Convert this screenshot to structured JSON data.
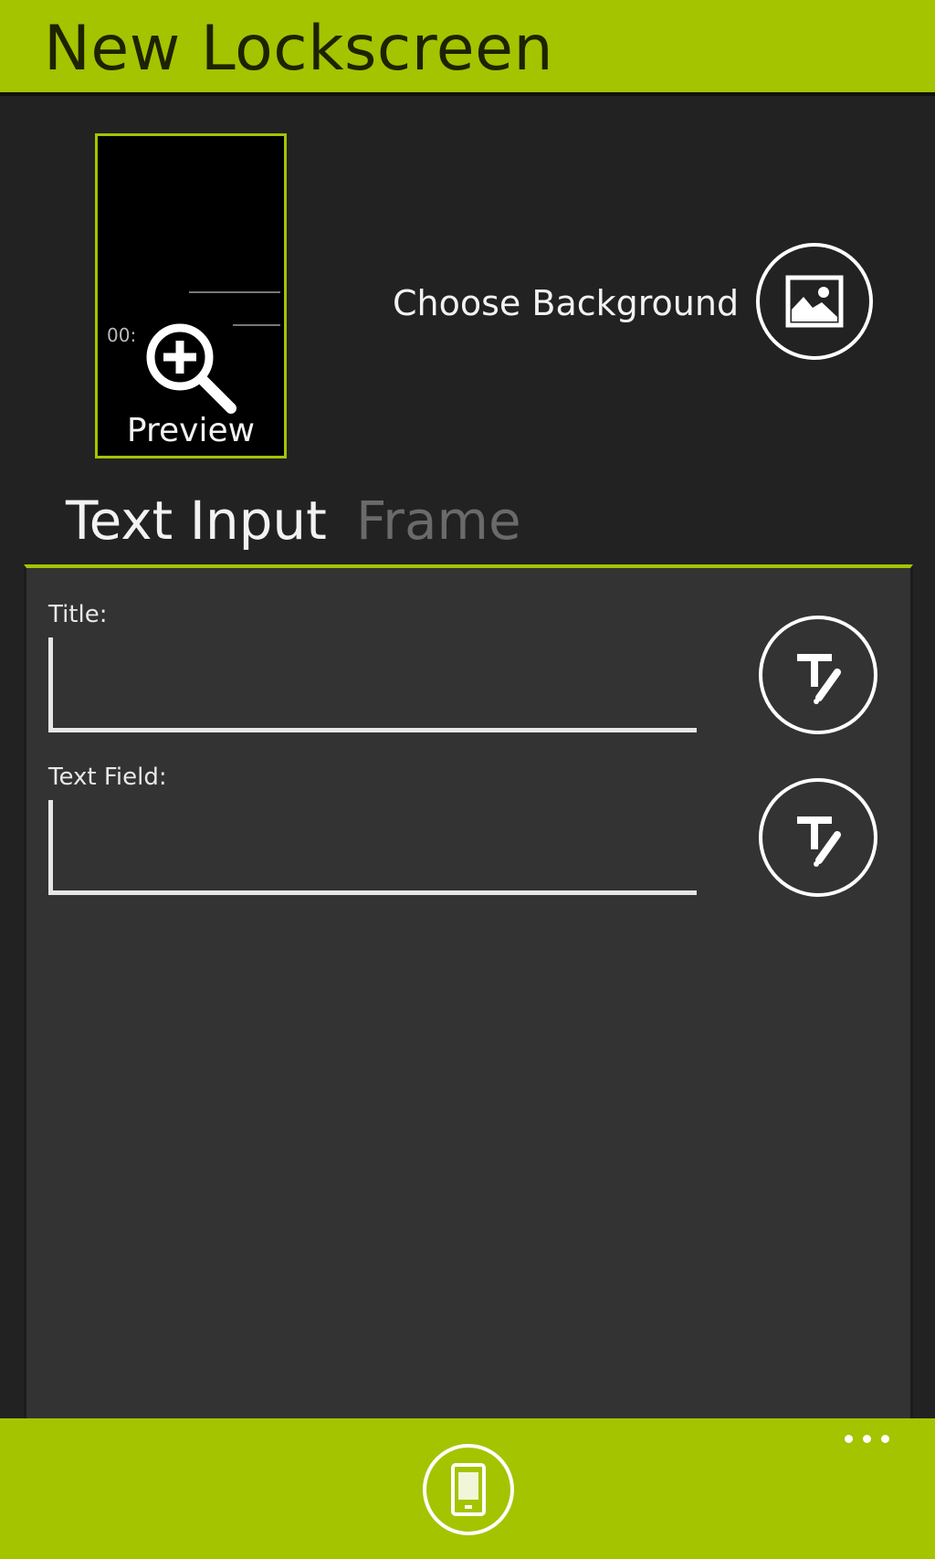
{
  "header": {
    "title": "New Lockscreen"
  },
  "preview": {
    "label": "Preview",
    "time_text": "00:"
  },
  "background": {
    "label": "Choose Background"
  },
  "tabs": [
    {
      "label": "Text Input",
      "active": true
    },
    {
      "label": "Frame",
      "active": false
    }
  ],
  "fields": [
    {
      "label": "Title:",
      "value": "",
      "placeholder": ""
    },
    {
      "label": "Text Field:",
      "value": "",
      "placeholder": ""
    }
  ],
  "appbar": {
    "main_icon": "phone-icon",
    "more_icon": "ellipsis-icon"
  },
  "colors": {
    "accent": "#a4c400",
    "background": "#222222",
    "panel": "#333333",
    "text": "#f2f2f2",
    "inactive_tab": "#6a6a6a"
  }
}
